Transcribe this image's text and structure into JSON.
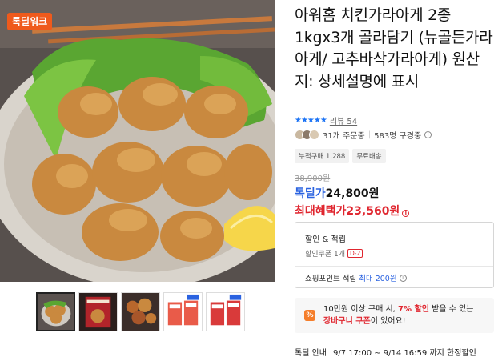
{
  "brand": {
    "badge": "톡딜워크"
  },
  "product": {
    "title": "아워홈 치킨가라아게 2종 1kgx3개 골라담기 (뉴골든가라아게/ 고추바삭가라아게) 원산지: 상세설명에 표시"
  },
  "rating": {
    "stars": "★★★★★",
    "review_label": "리뷰 54"
  },
  "social": {
    "orders": "31개 주문중",
    "watching": "583명 구경중"
  },
  "tags": [
    "누적구매 1,288",
    "무료배송"
  ],
  "price": {
    "original": "38,900원",
    "deal_label": "톡딜가",
    "deal_price": "24,800원",
    "max_label": "최대혜택가",
    "max_price": "23,560원"
  },
  "benefits": {
    "title": "할인 & 적립",
    "coupon": "할인쿠폰 1개",
    "coupon_badge": "D-2",
    "point_label": "쇼핑포인트 적립",
    "point_prefix": "최대",
    "point_value": "200원"
  },
  "promo": {
    "icon": "%",
    "line1_a": "10만원 이상 구매 시, ",
    "line1_b": "7% 할인",
    "line1_c": " 받을 수 있는",
    "line2_a": "장바구니 쿠폰",
    "line2_b": "이 있어요!"
  },
  "deal_info": {
    "label": "톡딜 안내",
    "period": "9/7 17:00 ~ 9/14 16:59 까지 한정할인"
  },
  "thumbnails": [
    "thumb-1",
    "thumb-2",
    "thumb-3",
    "thumb-4",
    "thumb-5"
  ],
  "colors": {
    "accent_blue": "#2a62e0",
    "accent_red": "#e0262f",
    "brand_orange": "#ef5a1c"
  }
}
